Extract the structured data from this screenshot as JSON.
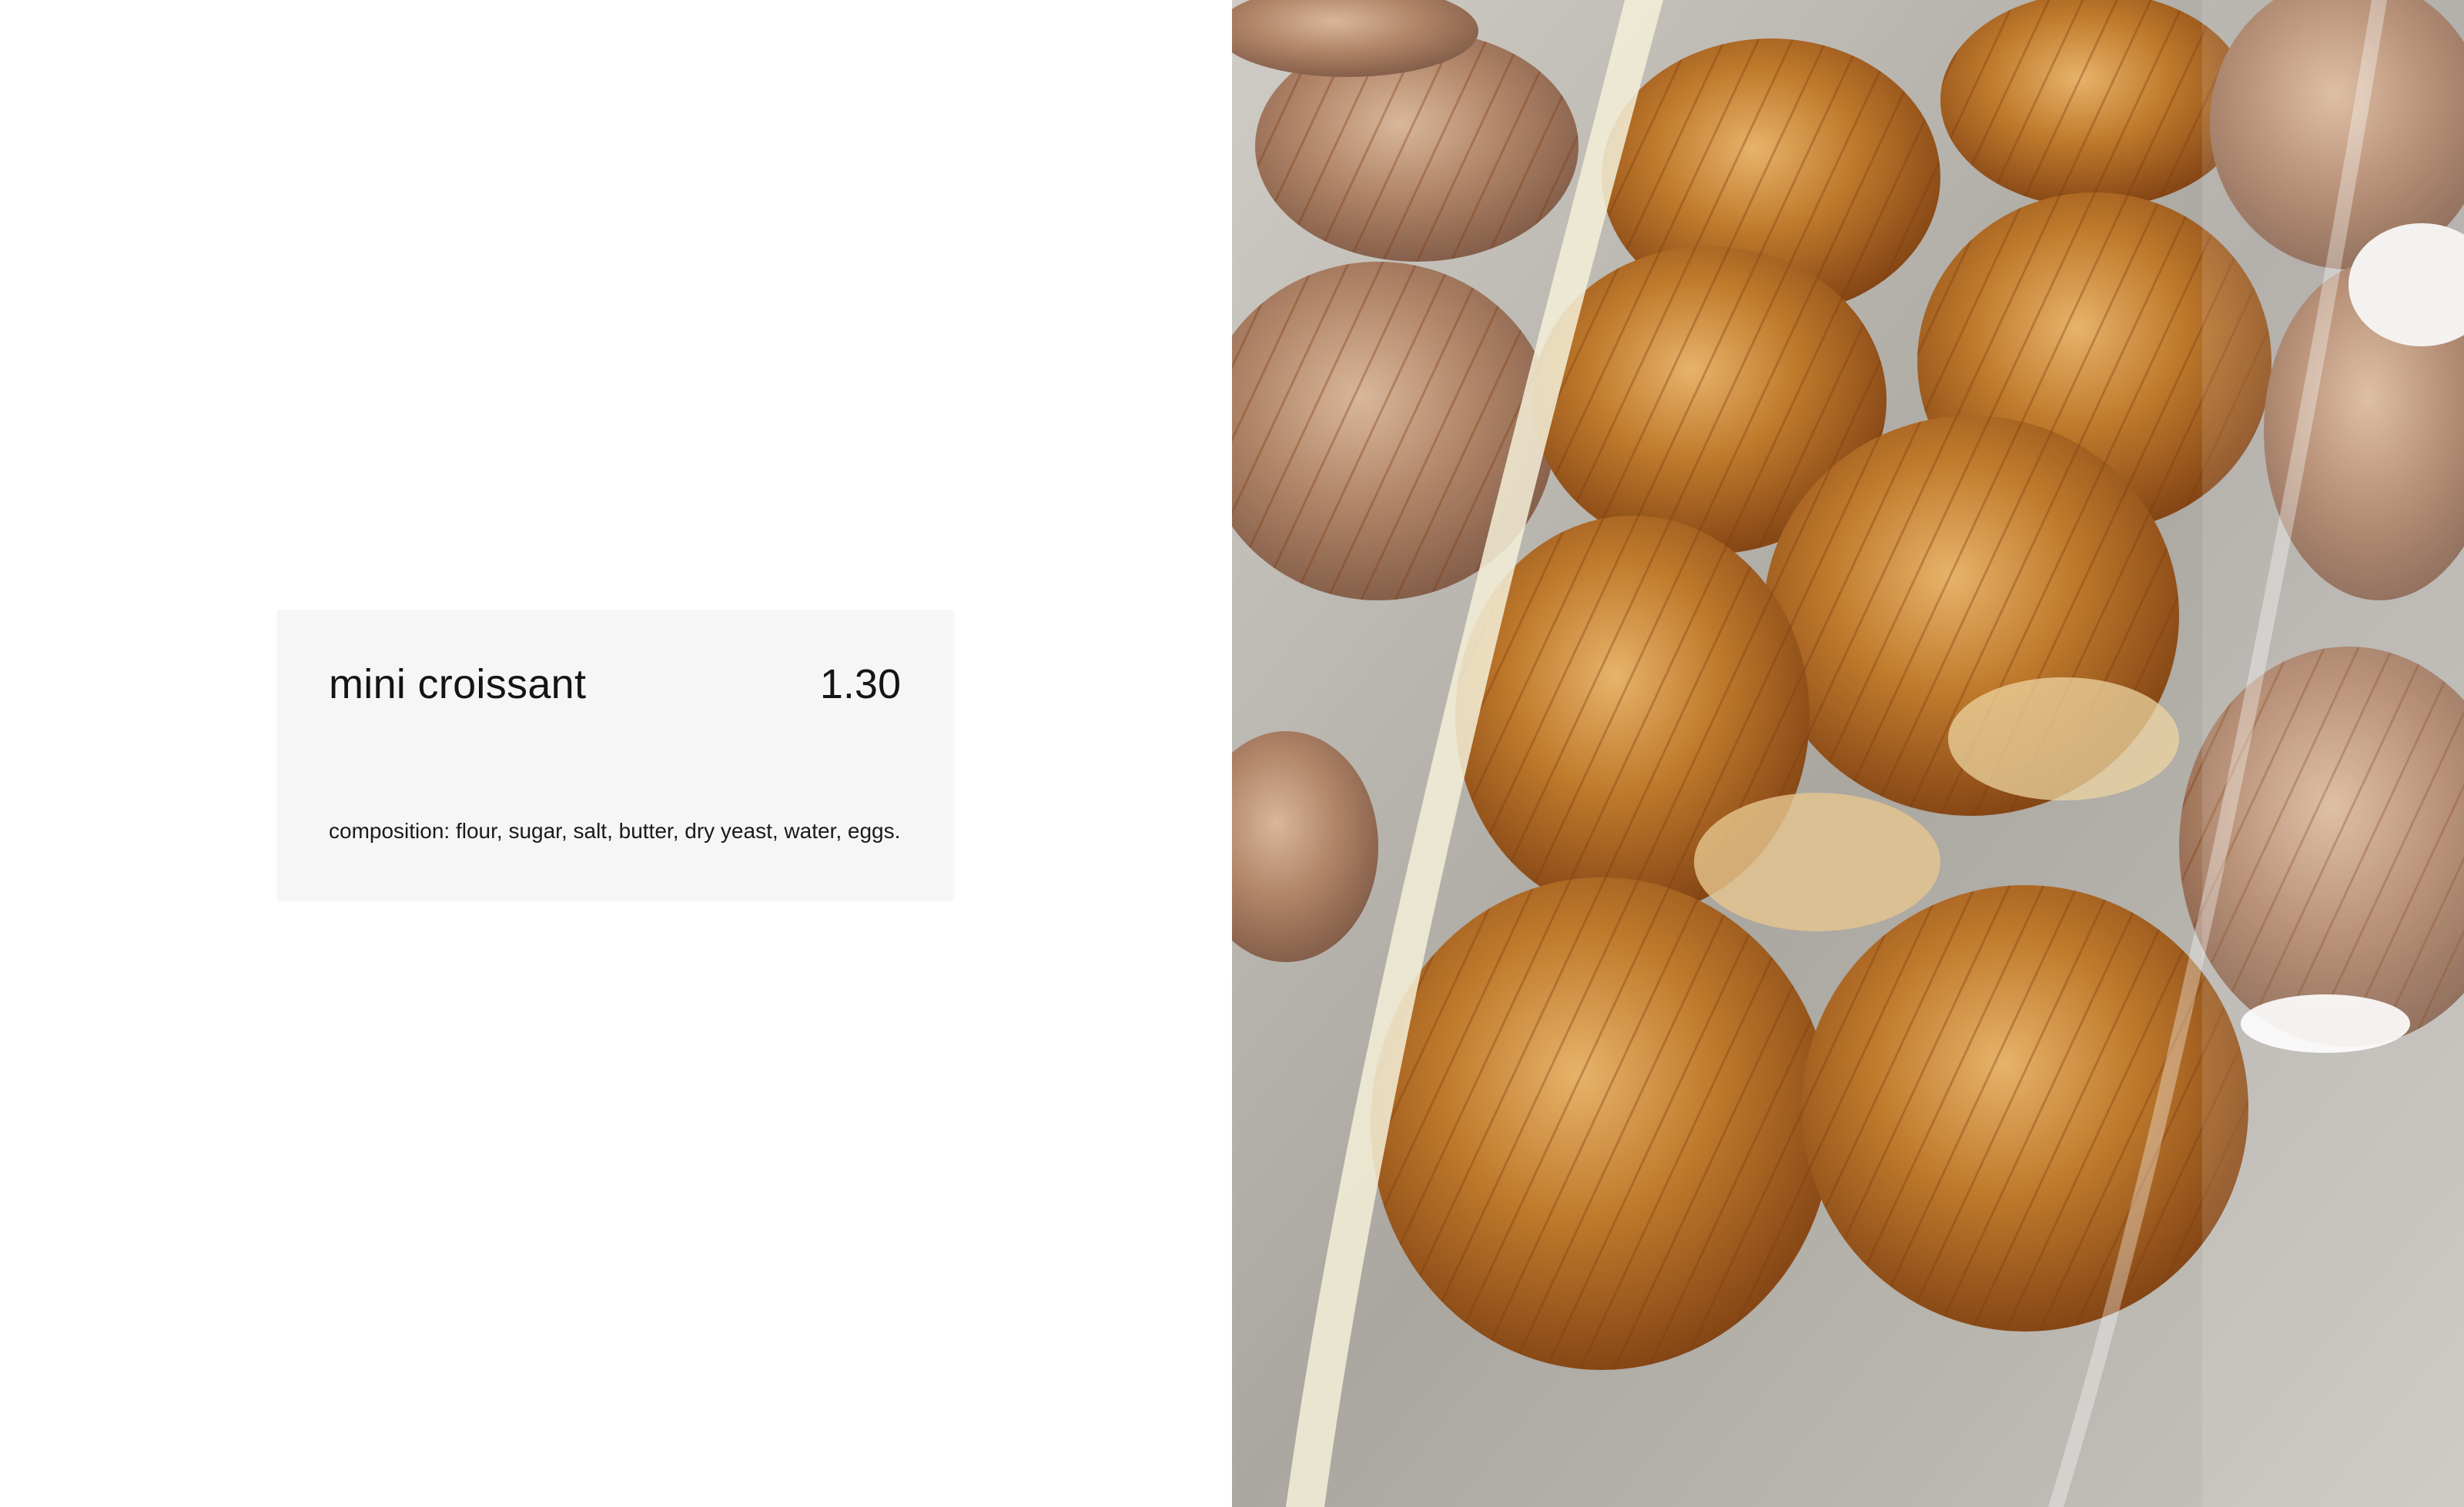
{
  "product_card": {
    "name": "mini croissant",
    "price": "1.30",
    "composition": "composition: flour, sugar, salt, butter, dry yeast, water, eggs."
  },
  "photo": {
    "subject": "mini croissants on a metal tray behind display glass",
    "colors": {
      "pastry_dark": "#8a4a16",
      "pastry_mid": "#c07a2c",
      "pastry_light": "#e6b36a",
      "tray": "#b3afa8",
      "background": "#ffffff",
      "card": "#f6f6f6"
    }
  }
}
